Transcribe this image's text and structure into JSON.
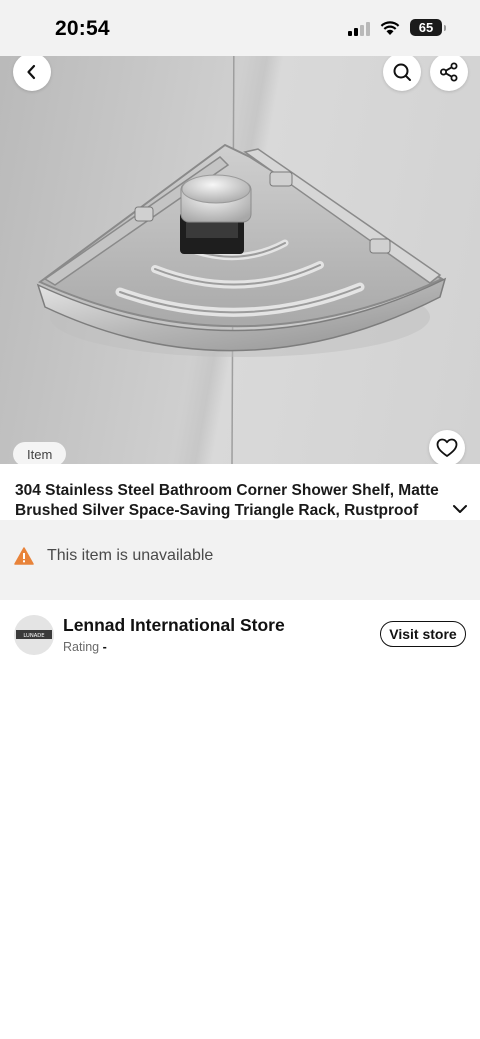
{
  "status_bar": {
    "time": "20:54",
    "battery": "65"
  },
  "hero": {
    "item_badge": "Item"
  },
  "product": {
    "title": "304 Stainless Steel Bathroom Corner Shower Shelf, Matte Brushed Silver Space-Saving Triangle Rack, Rustproof Modern"
  },
  "availability": {
    "message": "This item is unavailable",
    "icon": "warning-icon",
    "icon_color": "#e8833a"
  },
  "store": {
    "name": "Lennad International Store",
    "rating_label": "Rating",
    "rating_value": "-",
    "visit_label": "Visit store",
    "logo_text": "LUNADE"
  },
  "icons": {
    "back": "chevron-left-icon",
    "search": "search-icon",
    "share": "share-icon",
    "favorite": "heart-icon",
    "expand": "chevron-down-icon"
  }
}
